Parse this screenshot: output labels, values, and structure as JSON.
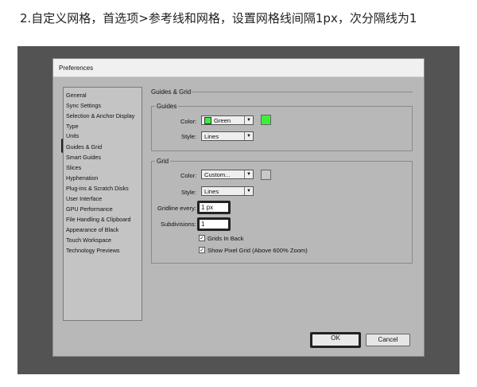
{
  "caption": "2.自定义网格，首选项>参考线和网格，设置网格线间隔1px，次分隔线为1",
  "dialog": {
    "title": "Preferences",
    "sidebar": {
      "items": [
        {
          "label": "General"
        },
        {
          "label": "Sync Settings"
        },
        {
          "label": "Selection & Anchor Display"
        },
        {
          "label": "Type"
        },
        {
          "label": "Units"
        },
        {
          "label": "Guides & Grid",
          "selected": true
        },
        {
          "label": "Smart Guides"
        },
        {
          "label": "Slices"
        },
        {
          "label": "Hyphenation"
        },
        {
          "label": "Plug-ins & Scratch Disks"
        },
        {
          "label": "User Interface"
        },
        {
          "label": "GPU Performance"
        },
        {
          "label": "File Handling & Clipboard"
        },
        {
          "label": "Appearance of Black"
        },
        {
          "label": "Touch Workspace"
        },
        {
          "label": "Technology Previews"
        }
      ]
    },
    "section_title": "Guides & Grid",
    "guides": {
      "legend": "Guides",
      "color_label": "Color:",
      "color_value": "Green",
      "color_hex": "#3dee3d",
      "style_label": "Style:",
      "style_value": "Lines"
    },
    "grid": {
      "legend": "Grid",
      "color_label": "Color:",
      "color_value": "Custom...",
      "color_hex": "#c8c8c8",
      "style_label": "Style:",
      "style_value": "Lines",
      "gridline_label": "Gridline every:",
      "gridline_value": "1 px",
      "subdivisions_label": "Subdivisions:",
      "subdivisions_value": "1",
      "grids_in_back_label": "Grids In Back",
      "grids_in_back_checked": true,
      "show_pixel_grid_label": "Show Pixel Grid (Above 600% Zoom)",
      "show_pixel_grid_checked": true
    },
    "buttons": {
      "ok": "OK",
      "cancel": "Cancel"
    }
  }
}
